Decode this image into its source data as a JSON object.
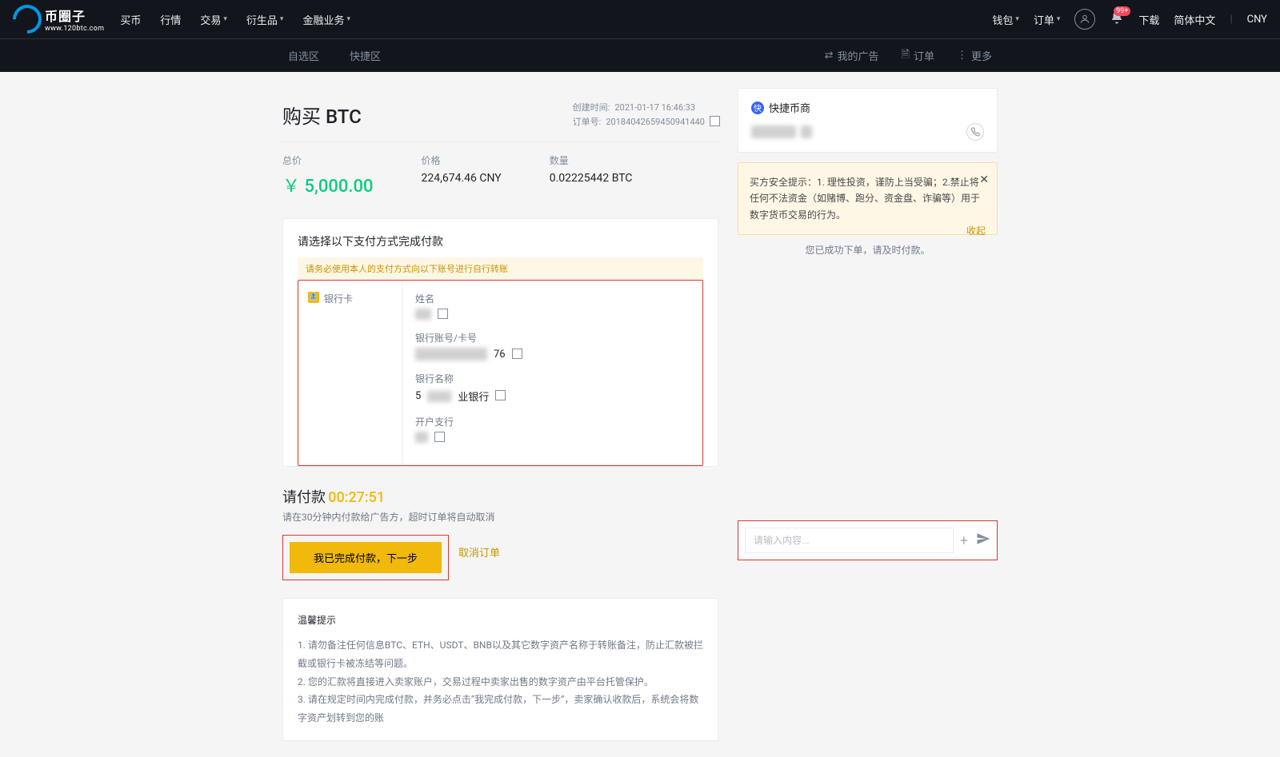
{
  "logo": {
    "cn": "币圈子",
    "url": "www.120btc.com"
  },
  "nav": {
    "left": [
      "买币",
      "行情",
      "交易",
      "衍生品",
      "金融业务"
    ],
    "right": {
      "wallet": "钱包",
      "orders": "订单",
      "download": "下载",
      "lang": "简体中文",
      "currency": "CNY"
    },
    "badge": "99+"
  },
  "subheader": {
    "tabs": [
      "自选区",
      "快捷区"
    ],
    "links": {
      "my_ads": "我的广告",
      "orders": "订单",
      "more": "更多"
    }
  },
  "page": {
    "title": "购买 BTC",
    "meta": {
      "created_label": "创建时间:",
      "created_value": "2021-01-17 16:46:33",
      "order_label": "订单号:",
      "order_value": "20184042659450941440"
    },
    "stats": {
      "total_label": "总价",
      "total_value": "￥ 5,000.00",
      "price_label": "价格",
      "price_value": "224,674.46 CNY",
      "qty_label": "数量",
      "qty_value": "0.02225442 BTC"
    }
  },
  "payment": {
    "section_title": "请选择以下支付方式完成付款",
    "warning": "请务必使用本人的支付方式向以下账号进行自行转账",
    "method": "银行卡",
    "fields": {
      "name_label": "姓名",
      "name_value": "█",
      "account_label": "银行账号/卡号",
      "account_value": "██████76",
      "bank_label": "银行名称",
      "bank_value": "██业银行",
      "branch_label": "开户支行",
      "branch_value": "█"
    }
  },
  "timer": {
    "label": "请付款",
    "value": "00:27:51",
    "hint": "请在30分钟内付款给广告方，超时订单将自动取消",
    "confirm_btn": "我已完成付款，下一步",
    "cancel": "取消订单"
  },
  "tips": {
    "title": "温馨提示",
    "items": [
      "1. 请勿备注任何信息BTC、ETH、USDT、BNB以及其它数字资产名称于转账备注，防止汇款被拦截或银行卡被冻结等问题。",
      "2. 您的汇款将直接进入卖家账户，交易过程中卖家出售的数字资产由平台托管保护。",
      "3. 请在规定时间内完成付款，并务必点击“我完成付款，下一步”，卖家确认收款后，系统会将数字资产划转到您的账"
    ]
  },
  "merchant": {
    "title": "快捷币商",
    "notice": "买方安全提示：1. 理性投资，谨防上当受骗；2.禁止将任何不法资金（如赌博、跑分、资金盘、诈骗等）用于数字货币交易的行为。",
    "collapse": "收起",
    "status": "您已成功下单，请及时付款。"
  },
  "chat": {
    "placeholder": "请输入内容..."
  }
}
